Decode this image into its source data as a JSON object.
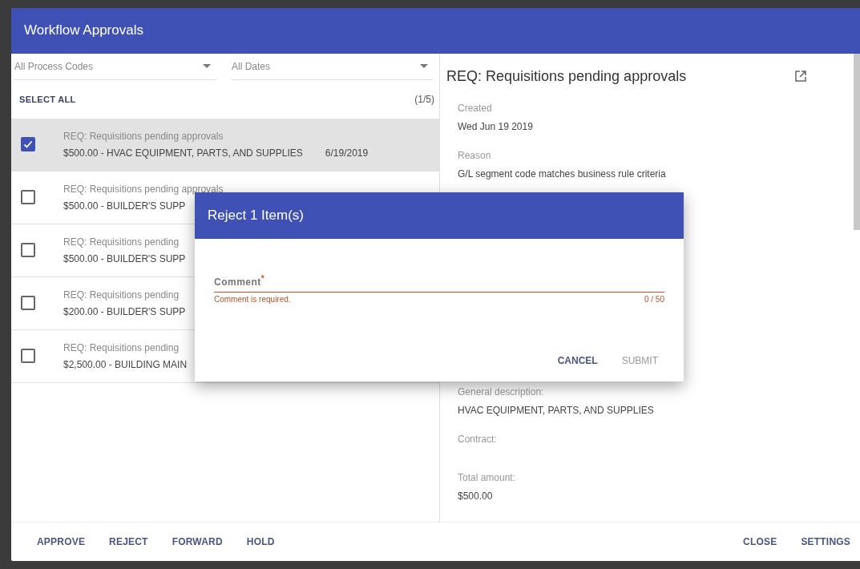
{
  "window": {
    "title": "Workflow Approvals"
  },
  "filters": [
    {
      "placeholder": "All Process Codes"
    },
    {
      "placeholder": "All Dates"
    }
  ],
  "select_all": {
    "label": "SELECT ALL",
    "count": "(1/5)"
  },
  "items": [
    {
      "title": "REQ: Requisitions pending approvals",
      "amount": "$500.00 - HVAC EQUIPMENT, PARTS, AND SUPPLIES",
      "date": "6/19/2019",
      "checked": true,
      "selected": true
    },
    {
      "title": "REQ: Requisitions pending approvals",
      "amount": "$500.00 - BUILDER'S SUPP",
      "checked": false,
      "selected": false
    },
    {
      "title": "REQ: Requisitions pending",
      "amount": "$500.00 - BUILDER'S SUPP",
      "checked": false,
      "selected": false
    },
    {
      "title": "REQ: Requisitions pending",
      "amount": "$200.00 - BUILDER'S SUPP",
      "checked": false,
      "selected": false
    },
    {
      "title": "REQ: Requisitions pending",
      "amount": "$2,500.00 - BUILDING MAIN",
      "checked": false,
      "selected": false
    }
  ],
  "detail": {
    "title": "REQ: Requisitions pending approvals",
    "fields": [
      {
        "label": "Created",
        "value": "Wed Jun 19 2019"
      },
      {
        "label": "Reason",
        "value": "G/L segment code matches business rule criteria"
      },
      {
        "label": "General description:",
        "value": "HVAC EQUIPMENT, PARTS, AND SUPPLIES"
      },
      {
        "label": "Contract:"
      },
      {
        "label": "Total amount:",
        "value": "$500.00"
      }
    ]
  },
  "footer": {
    "left_buttons": [
      "APPROVE",
      "REJECT",
      "FORWARD",
      "HOLD"
    ],
    "right_buttons": [
      "CLOSE",
      "SETTINGS"
    ]
  },
  "dialog": {
    "title": "Reject 1 Item(s)",
    "field": {
      "label": "Comment",
      "required_mark": "*",
      "error": "Comment is required.",
      "counter": "0 / 50"
    },
    "buttons": [
      {
        "label": "CANCEL",
        "disabled": false
      },
      {
        "label": "SUBMIT",
        "disabled": true
      }
    ]
  }
}
